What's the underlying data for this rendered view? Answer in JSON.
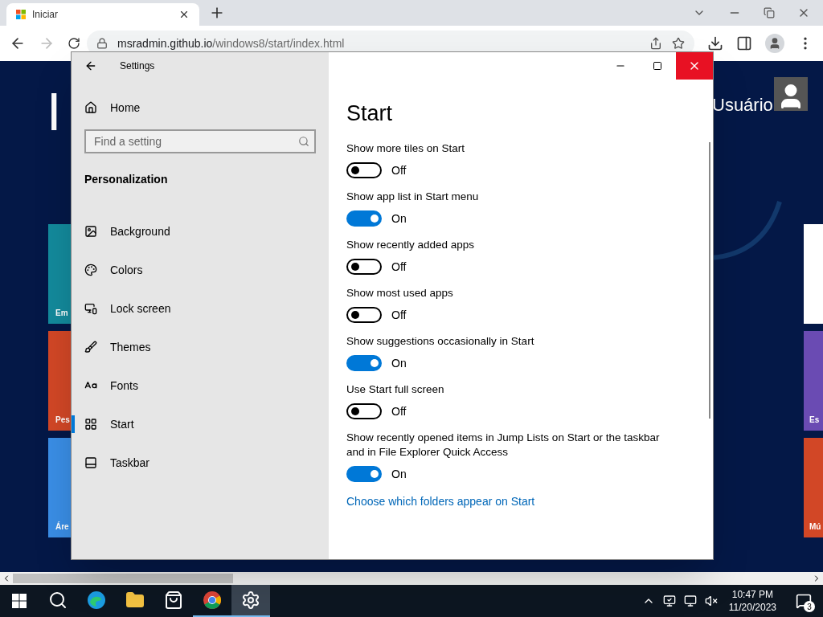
{
  "browser": {
    "tab": {
      "title": "Iniciar"
    },
    "url": {
      "host": "msradmin.github.io",
      "path": "/windows8/start/index.html"
    }
  },
  "start_page": {
    "heading": "I",
    "user": "Usuário",
    "tiles_left": [
      {
        "label": "Em",
        "color": "#138a9c"
      },
      {
        "label": "Pes",
        "color": "#d24726"
      },
      {
        "label": "Áre",
        "color": "#3a8ee6"
      }
    ],
    "tiles_right": [
      {
        "color": "#ffffff"
      },
      {
        "label": "Es",
        "color": "#6a4bb3"
      },
      {
        "label": "Mú",
        "color": "#d24726"
      }
    ]
  },
  "settings": {
    "title": "Settings",
    "home": "Home",
    "search": {
      "placeholder": "Find a setting"
    },
    "section": "Personalization",
    "nav": [
      {
        "label": "Background",
        "kind": "background",
        "selected": false
      },
      {
        "label": "Colors",
        "kind": "colors",
        "selected": false
      },
      {
        "label": "Lock screen",
        "kind": "lock",
        "selected": false
      },
      {
        "label": "Themes",
        "kind": "themes",
        "selected": false
      },
      {
        "label": "Fonts",
        "kind": "fonts",
        "selected": false
      },
      {
        "label": "Start",
        "kind": "start",
        "selected": true
      },
      {
        "label": "Taskbar",
        "kind": "taskbar",
        "selected": false
      }
    ],
    "page_title": "Start",
    "options": [
      {
        "label": "Show more tiles on Start",
        "on": false,
        "state": "Off"
      },
      {
        "label": "Show app list in Start menu",
        "on": true,
        "state": "On"
      },
      {
        "label": "Show recently added apps",
        "on": false,
        "state": "Off"
      },
      {
        "label": "Show most used apps",
        "on": false,
        "state": "Off"
      },
      {
        "label": "Show suggestions occasionally in Start",
        "on": true,
        "state": "On"
      },
      {
        "label": "Use Start full screen",
        "on": false,
        "state": "Off"
      },
      {
        "label": "Show recently opened items in Jump Lists on Start or the taskbar and in File Explorer Quick Access",
        "on": true,
        "state": "On"
      }
    ],
    "link": "Choose which folders appear on Start"
  },
  "taskbar": {
    "apps": [
      {
        "kind": "search",
        "active": false
      },
      {
        "kind": "edge",
        "active": false
      },
      {
        "kind": "explorer",
        "active": false
      },
      {
        "kind": "store",
        "active": false
      },
      {
        "kind": "chrome",
        "active": true
      },
      {
        "kind": "settings",
        "active": true
      }
    ],
    "time": "10:47 PM",
    "date": "11/20/2023",
    "notifications": "3"
  }
}
